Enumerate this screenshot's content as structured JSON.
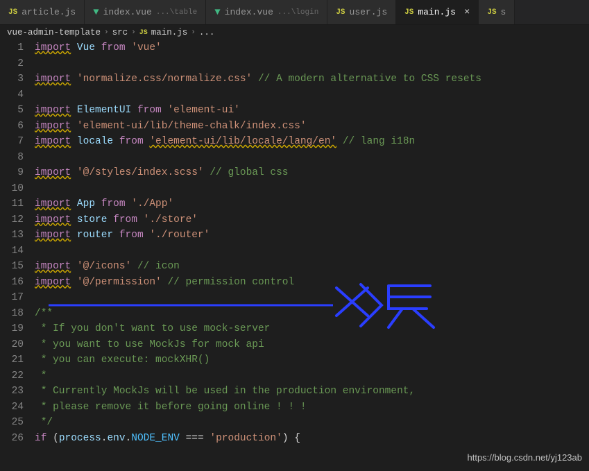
{
  "tabs": [
    {
      "icon": "js",
      "label": "article.js",
      "active": false
    },
    {
      "icon": "vue",
      "label": "index.vue",
      "path": "...\\table",
      "active": false
    },
    {
      "icon": "vue",
      "label": "index.vue",
      "path": "...\\login",
      "active": false
    },
    {
      "icon": "js",
      "label": "user.js",
      "active": false
    },
    {
      "icon": "js",
      "label": "main.js",
      "active": true,
      "closable": true
    },
    {
      "icon": "js",
      "label": "s",
      "active": false
    }
  ],
  "breadcrumb": {
    "parts": [
      "vue-admin-template",
      "src"
    ],
    "file_icon": "JS",
    "file": "main.js",
    "trailing": "..."
  },
  "code": {
    "lines": [
      {
        "n": 1,
        "tokens": [
          [
            "kw wavy",
            "import"
          ],
          [
            "pun",
            " "
          ],
          [
            "var",
            "Vue"
          ],
          [
            "pun",
            " "
          ],
          [
            "kw",
            "from"
          ],
          [
            "pun",
            " "
          ],
          [
            "str",
            "'vue'"
          ]
        ]
      },
      {
        "n": 2,
        "tokens": []
      },
      {
        "n": 3,
        "tokens": [
          [
            "kw wavy",
            "import"
          ],
          [
            "pun",
            " "
          ],
          [
            "str",
            "'normalize.css/normalize.css'"
          ],
          [
            "pun",
            " "
          ],
          [
            "com",
            "// A modern alternative to CSS resets"
          ]
        ]
      },
      {
        "n": 4,
        "tokens": []
      },
      {
        "n": 5,
        "tokens": [
          [
            "kw wavy",
            "import"
          ],
          [
            "pun",
            " "
          ],
          [
            "var",
            "ElementUI"
          ],
          [
            "pun",
            " "
          ],
          [
            "kw",
            "from"
          ],
          [
            "pun",
            " "
          ],
          [
            "str",
            "'element-ui'"
          ]
        ]
      },
      {
        "n": 6,
        "tokens": [
          [
            "kw wavy",
            "import"
          ],
          [
            "pun",
            " "
          ],
          [
            "str",
            "'element-ui/lib/theme-chalk/index.css'"
          ]
        ]
      },
      {
        "n": 7,
        "tokens": [
          [
            "kw wavy",
            "import"
          ],
          [
            "pun",
            " "
          ],
          [
            "var",
            "locale"
          ],
          [
            "pun",
            " "
          ],
          [
            "kw",
            "from"
          ],
          [
            "pun",
            " "
          ],
          [
            "str wavy",
            "'element-ui/lib/locale/lang/en'"
          ],
          [
            "pun",
            " "
          ],
          [
            "com",
            "// lang i18n"
          ]
        ]
      },
      {
        "n": 8,
        "tokens": []
      },
      {
        "n": 9,
        "tokens": [
          [
            "kw wavy",
            "import"
          ],
          [
            "pun",
            " "
          ],
          [
            "str",
            "'@/styles/index.scss'"
          ],
          [
            "pun",
            " "
          ],
          [
            "com",
            "// global css"
          ]
        ]
      },
      {
        "n": 10,
        "tokens": []
      },
      {
        "n": 11,
        "tokens": [
          [
            "kw wavy",
            "import"
          ],
          [
            "pun",
            " "
          ],
          [
            "var",
            "App"
          ],
          [
            "pun",
            " "
          ],
          [
            "kw",
            "from"
          ],
          [
            "pun",
            " "
          ],
          [
            "str",
            "'./App'"
          ]
        ]
      },
      {
        "n": 12,
        "tokens": [
          [
            "kw wavy",
            "import"
          ],
          [
            "pun",
            " "
          ],
          [
            "var",
            "store"
          ],
          [
            "pun",
            " "
          ],
          [
            "kw",
            "from"
          ],
          [
            "pun",
            " "
          ],
          [
            "str",
            "'./store'"
          ]
        ]
      },
      {
        "n": 13,
        "tokens": [
          [
            "kw wavy",
            "import"
          ],
          [
            "pun",
            " "
          ],
          [
            "var",
            "router"
          ],
          [
            "pun",
            " "
          ],
          [
            "kw",
            "from"
          ],
          [
            "pun",
            " "
          ],
          [
            "str",
            "'./router'"
          ]
        ]
      },
      {
        "n": 14,
        "tokens": []
      },
      {
        "n": 15,
        "tokens": [
          [
            "kw wavy",
            "import"
          ],
          [
            "pun",
            " "
          ],
          [
            "str",
            "'@/icons'"
          ],
          [
            "pun",
            " "
          ],
          [
            "com",
            "// icon"
          ]
        ]
      },
      {
        "n": 16,
        "tokens": [
          [
            "kw wavy",
            "import"
          ],
          [
            "pun",
            " "
          ],
          [
            "str",
            "'@/permission'"
          ],
          [
            "pun",
            " "
          ],
          [
            "com",
            "// permission control"
          ]
        ]
      },
      {
        "n": 17,
        "tokens": []
      },
      {
        "n": 18,
        "tokens": [
          [
            "com",
            "/**"
          ]
        ]
      },
      {
        "n": 19,
        "tokens": [
          [
            "com",
            " * If you don't want to use mock-server"
          ]
        ]
      },
      {
        "n": 20,
        "tokens": [
          [
            "com",
            " * you want to use MockJs for mock api"
          ]
        ]
      },
      {
        "n": 21,
        "tokens": [
          [
            "com",
            " * you can execute: mockXHR()"
          ]
        ]
      },
      {
        "n": 22,
        "tokens": [
          [
            "com",
            " *"
          ]
        ]
      },
      {
        "n": 23,
        "tokens": [
          [
            "com",
            " * Currently MockJs will be used in the production environment,"
          ]
        ]
      },
      {
        "n": 24,
        "tokens": [
          [
            "com",
            " * please remove it before going online ! ! !"
          ]
        ]
      },
      {
        "n": 25,
        "tokens": [
          [
            "com",
            " */"
          ]
        ]
      },
      {
        "n": 26,
        "tokens": [
          [
            "kw",
            "if"
          ],
          [
            "pun",
            " ("
          ],
          [
            "prop",
            "process"
          ],
          [
            "pun",
            "."
          ],
          [
            "prop",
            "env"
          ],
          [
            "pun",
            "."
          ],
          [
            "const",
            "NODE_ENV"
          ],
          [
            "pun",
            " "
          ],
          [
            "op",
            "==="
          ],
          [
            "pun",
            " "
          ],
          [
            "str",
            "'production'"
          ],
          [
            "pun",
            ") {"
          ]
        ]
      }
    ]
  },
  "annotation": {
    "handwriting": "权限",
    "color": "#2a3eff"
  },
  "watermark": "https://blog.csdn.net/yj123ab"
}
